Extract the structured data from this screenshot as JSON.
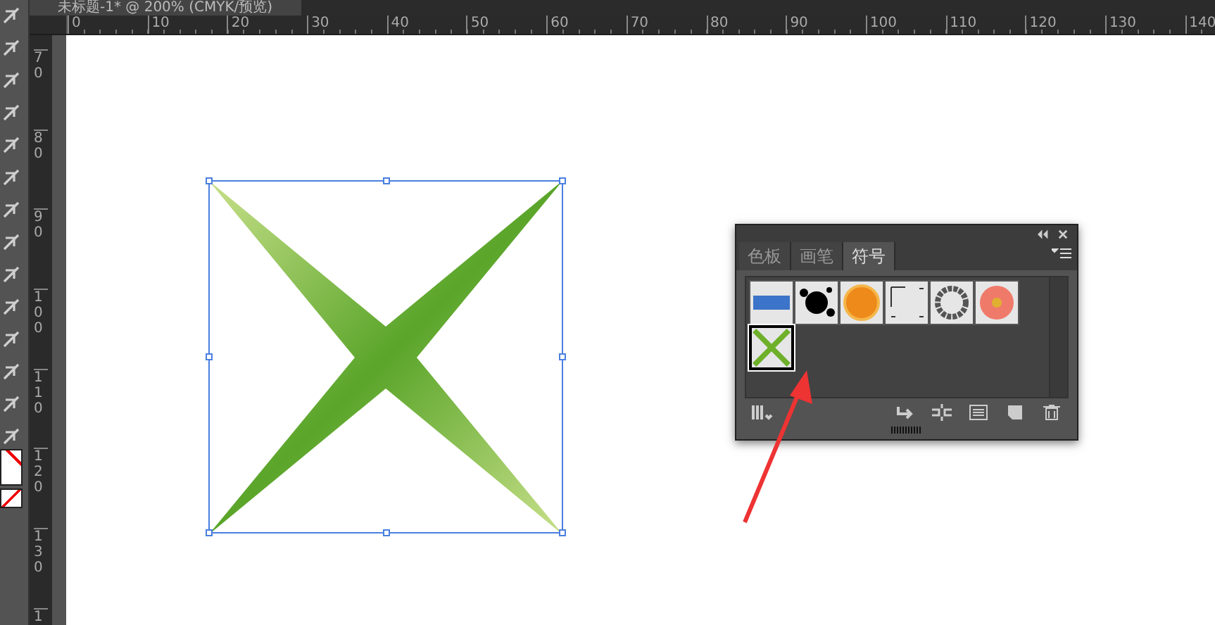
{
  "document_tab": {
    "title": "未标题-1* @ 200% (CMYK/预览)"
  },
  "horizontal_ruler": {
    "labels": [
      "0",
      "10",
      "20",
      "30",
      "40",
      "50",
      "60",
      "70",
      "80",
      "90",
      "100",
      "110",
      "120",
      "130",
      "140"
    ]
  },
  "vertical_ruler": {
    "labels": [
      "70",
      "80",
      "90",
      "100",
      "110",
      "120",
      "130",
      "1"
    ]
  },
  "symbols_panel": {
    "tabs": [
      {
        "label": "色板",
        "selected": false
      },
      {
        "label": "画笔",
        "selected": false
      },
      {
        "label": "符号",
        "selected": true
      }
    ],
    "symbols": [
      {
        "kind": "gradient-bar",
        "selected": false
      },
      {
        "kind": "splat",
        "selected": false
      },
      {
        "kind": "round-button",
        "selected": false
      },
      {
        "kind": "corner-marks",
        "selected": false
      },
      {
        "kind": "ring",
        "selected": false
      },
      {
        "kind": "flower",
        "selected": false
      },
      {
        "kind": "x-star",
        "selected": true
      }
    ]
  }
}
